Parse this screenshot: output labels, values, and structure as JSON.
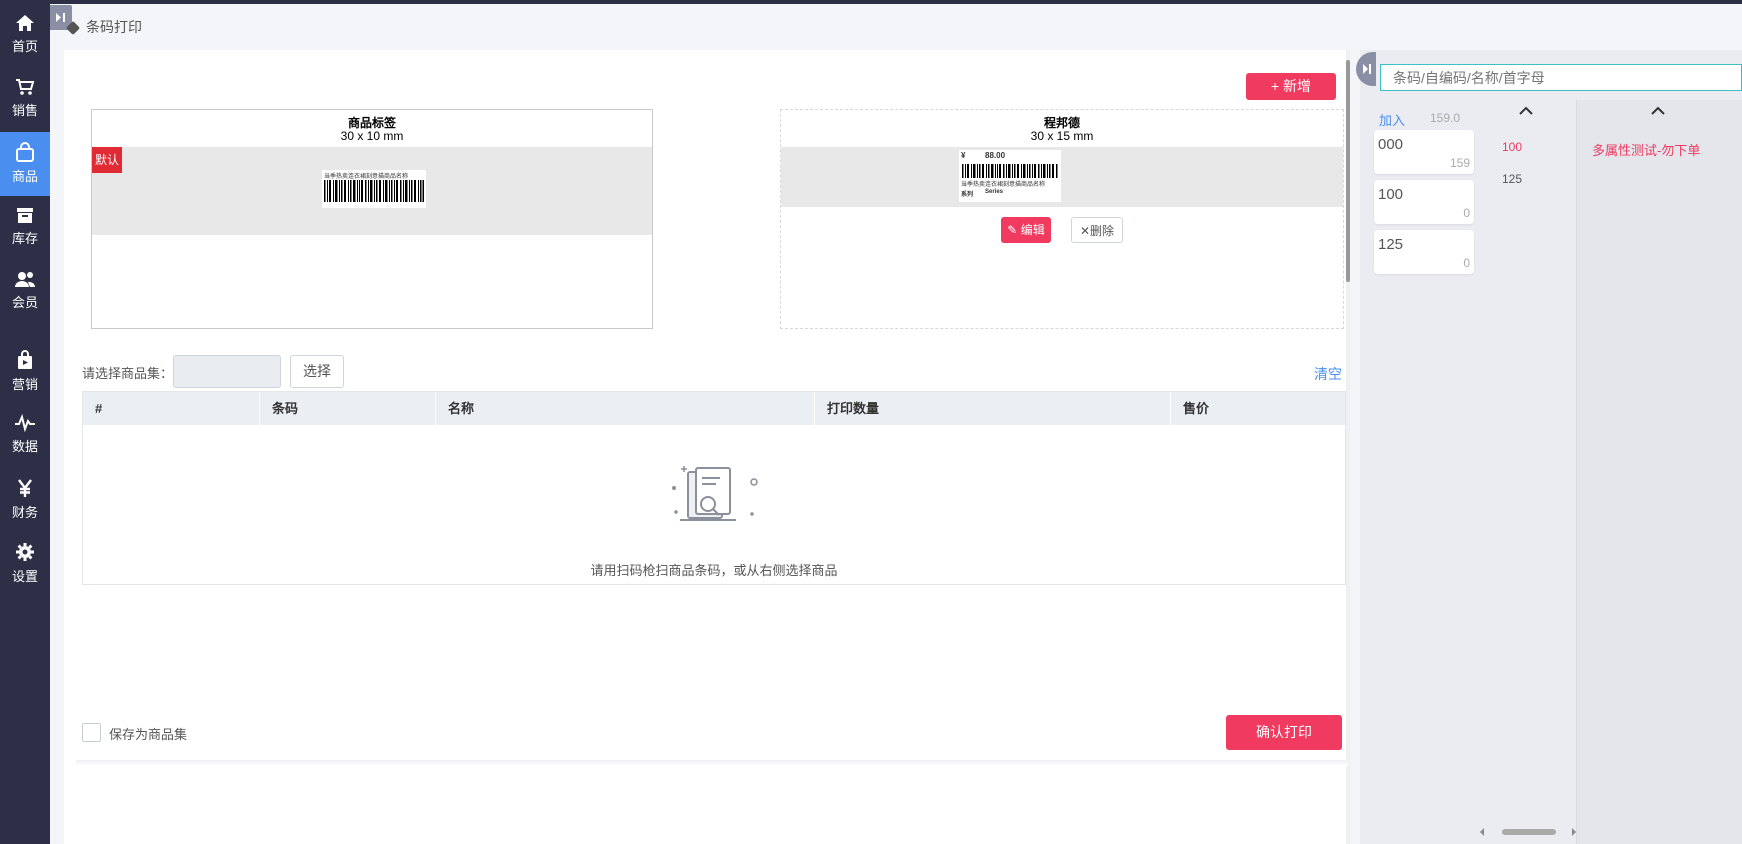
{
  "nav": {
    "items": [
      {
        "label": "首页",
        "icon": "home-icon"
      },
      {
        "label": "销售",
        "icon": "cart-icon"
      },
      {
        "label": "商品",
        "icon": "bag-icon",
        "active": true
      },
      {
        "label": "库存",
        "icon": "inventory-icon"
      },
      {
        "label": "会员",
        "icon": "members-icon"
      },
      {
        "label": "营销",
        "icon": "marketing-icon"
      },
      {
        "label": "数据",
        "icon": "pulse-icon"
      },
      {
        "label": "财务",
        "icon": "yen-icon"
      },
      {
        "label": "设置",
        "icon": "gear-icon"
      }
    ]
  },
  "breadcrumb": "条码打印",
  "toolbar": {
    "add_label": "+ 新增"
  },
  "label_cards": [
    {
      "name": "商品标签",
      "size": "30 x 10 mm",
      "badge": "默认",
      "preview_text": "当季热卖连衣裙刻意描商品名称"
    },
    {
      "name": "程邦德",
      "size": "30 x 15 mm",
      "price_symbol": "¥",
      "price": "88.00",
      "preview_name": "当季热卖连衣裙刻意描商品名称",
      "series_label": "系列",
      "series_value": "Series",
      "edit_label": "编辑",
      "delete_label": "删除"
    }
  ],
  "product_set": {
    "label": "请选择商品集：",
    "select_label": "选择",
    "clear_label": "清空"
  },
  "table": {
    "columns": [
      "#",
      "条码",
      "名称",
      "打印数量",
      "售价"
    ],
    "empty_text": "请用扫码枪扫商品条码，或从右侧选择商品"
  },
  "footer": {
    "save_set_label": "保存为商品集",
    "confirm_label": "确认打印"
  },
  "right_panel": {
    "search_placeholder": "条码/自编码/名称/首字母",
    "add_label": "加入",
    "add_value": "159.0",
    "variants": [
      {
        "value": "000",
        "stock": "159"
      },
      {
        "value": "100",
        "stock": "0"
      },
      {
        "value": "125",
        "stock": "0"
      }
    ],
    "sizes": [
      {
        "label": "100",
        "highlight": true
      },
      {
        "label": "125",
        "highlight": false
      }
    ],
    "product_name": "多属性测试-勿下单"
  },
  "colors": {
    "primary": "#f03a5f",
    "sidebar": "#2c2f45",
    "active": "#4a8ff0",
    "badge": "#e02b35",
    "link": "#4a8ff0"
  }
}
